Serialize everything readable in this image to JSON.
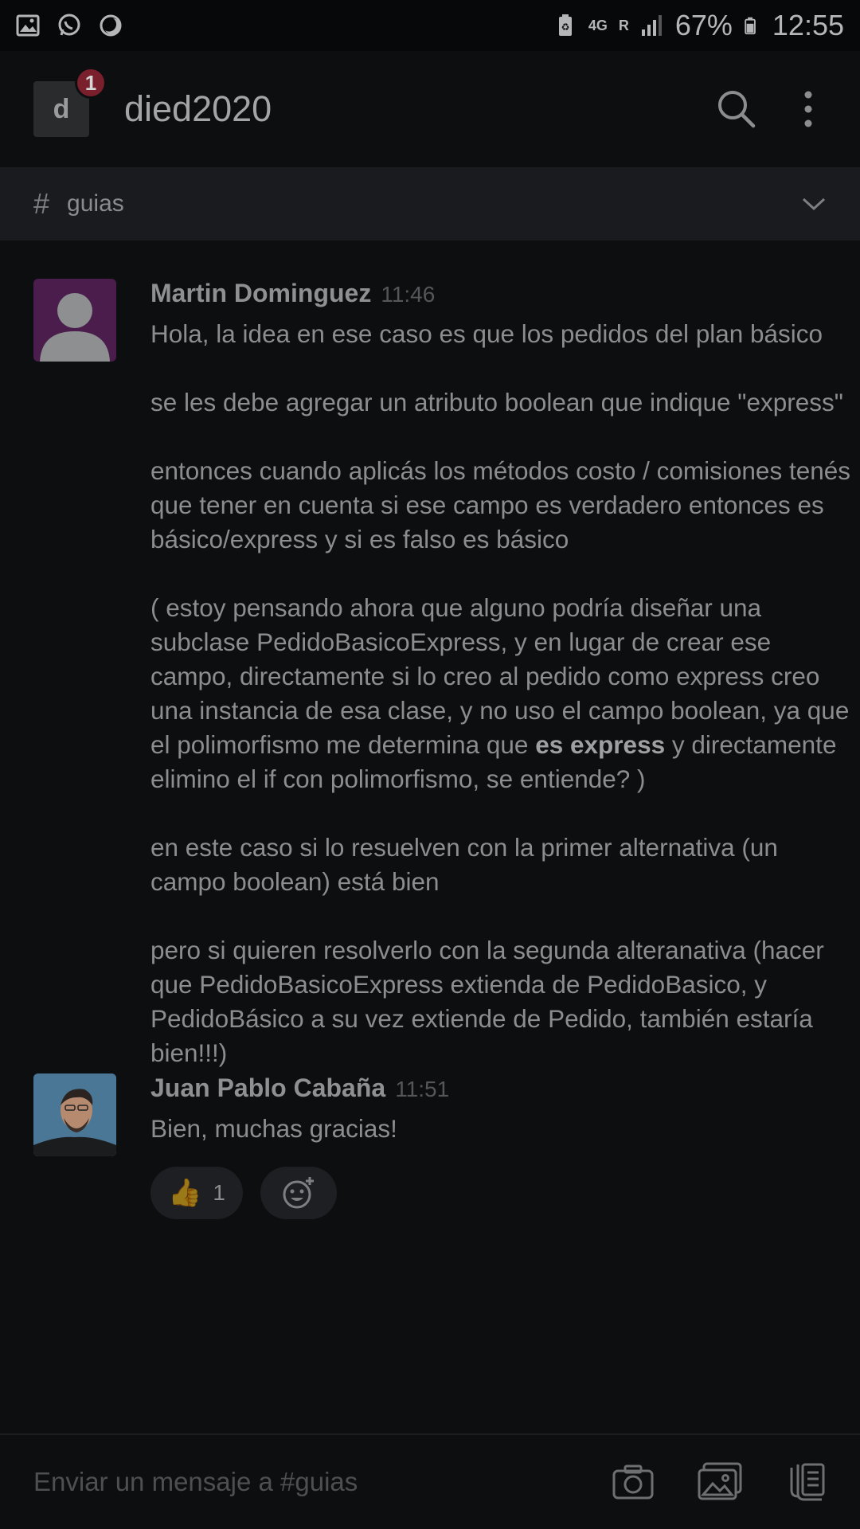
{
  "status_bar": {
    "network": "4G",
    "roaming": "R",
    "battery": "67%",
    "time": "12:55"
  },
  "header": {
    "workspace_initial": "d",
    "notification_count": "1",
    "workspace_name": "died2020"
  },
  "channel": {
    "hash": "#",
    "name": "guias"
  },
  "messages": [
    {
      "author": "Martin Dominguez",
      "time": "11:46",
      "paragraphs": [
        "Hola, la idea en ese caso es que los pedidos del plan básico",
        "se les debe agregar un atributo boolean que indique \"express\"",
        "entonces cuando aplicás los métodos costo  / comisiones tenés que tener en cuenta si ese campo es verdadero entonces es básico/express y si es falso es básico",
        "en este caso si lo resuelven con la primer alternativa (un campo boolean) está bien",
        "pero si quieren resolverlo con la segunda alteranativa (hacer que PedidoBasicoExpress extienda de PedidoBasico, y PedidoBásico a su vez extiende de Pedido, también estaría bien!!!)"
      ],
      "para4_before": "( estoy pensando ahora que alguno podría diseñar una subclase PedidoBasicoExpress, y en lugar de crear ese campo, directamente si lo creo al pedido como express creo una instancia de esa clase, y no uso el campo boolean, ya que el polimorfismo me determina que ",
      "para4_bold": "es express",
      "para4_after": " y directamente elimino el if con polimorfismo, se entiende? )"
    },
    {
      "author": "Juan Pablo Cabaña",
      "time": "11:51",
      "text": "Bien, muchas gracias!",
      "reaction_emoji": "👍",
      "reaction_count": "1"
    }
  ],
  "composer": {
    "placeholder": "Enviar un mensaje a #guias"
  },
  "colors": {
    "background": "#0d0e10",
    "channel_bar": "#1a1b1e",
    "badge": "#7a1f2c",
    "avatar_purple": "#4a1d4d"
  }
}
